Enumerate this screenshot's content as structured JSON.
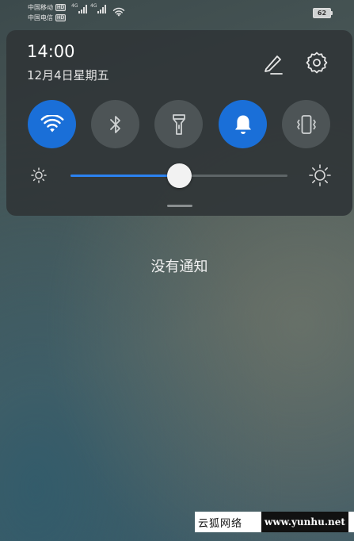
{
  "status_bar": {
    "carriers": [
      {
        "name": "中国移动",
        "badge": "HD"
      },
      {
        "name": "中国电信",
        "badge": "HD"
      }
    ],
    "network_types": [
      "4G",
      "4G"
    ],
    "battery_level": "62"
  },
  "quick_panel": {
    "time": "14:00",
    "date": "12月4日星期五",
    "edit_icon": "pencil-icon",
    "settings_icon": "gear-icon",
    "toggles": [
      {
        "id": "wifi",
        "icon": "wifi-icon",
        "state": "on"
      },
      {
        "id": "bluetooth",
        "icon": "bluetooth-icon",
        "state": "off"
      },
      {
        "id": "flashlight",
        "icon": "flashlight-icon",
        "state": "off"
      },
      {
        "id": "sound",
        "icon": "bell-icon",
        "state": "on"
      },
      {
        "id": "vibrate",
        "icon": "vibrate-icon",
        "state": "off"
      }
    ],
    "brightness": {
      "level": 0.5
    }
  },
  "notifications": {
    "empty_text": "没有通知"
  },
  "watermark": {
    "cn": "云狐网络",
    "url": "www.yunhu.net"
  },
  "colors": {
    "accent": "#1a6fd8",
    "tile_off": "#4d5456",
    "panel": "#303638"
  }
}
